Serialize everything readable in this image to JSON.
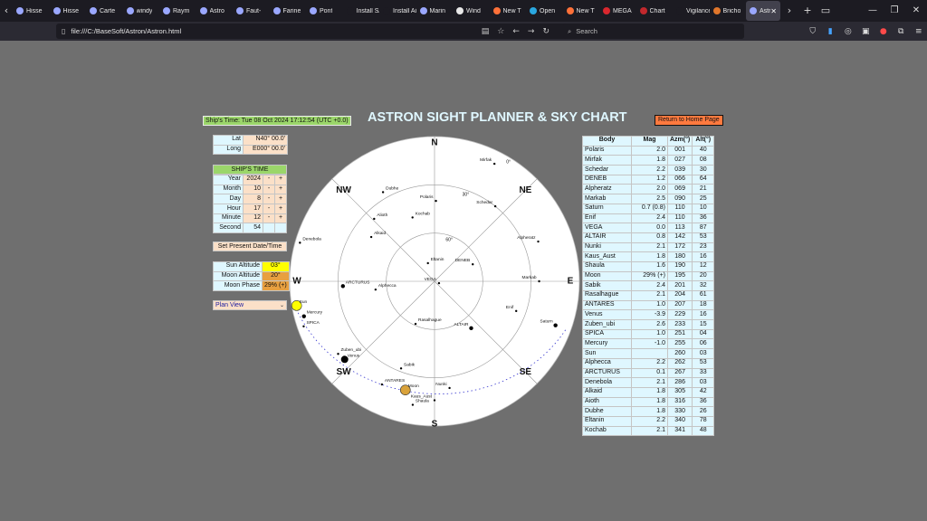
{
  "browser": {
    "tabs": [
      {
        "label": "Hisse",
        "color": "#9aa7ff"
      },
      {
        "label": "Hisse",
        "color": "#9aa7ff"
      },
      {
        "label": "Carte",
        "color": "#9aa7ff"
      },
      {
        "label": "windy",
        "color": "#9aa7ff"
      },
      {
        "label": "Raym",
        "color": "#9aa7ff"
      },
      {
        "label": "Astro",
        "color": "#9aa7ff"
      },
      {
        "label": "Faut-",
        "color": "#9aa7ff"
      },
      {
        "label": "Farine",
        "color": "#9aa7ff"
      },
      {
        "label": "Pont",
        "color": "#9aa7ff"
      },
      {
        "label": "Install SAS",
        "color": "#1c1b22"
      },
      {
        "label": "Install Airl",
        "color": "#1c1b22"
      },
      {
        "label": "Marin",
        "color": "#9aa7ff"
      },
      {
        "label": "Wind",
        "color": "#e8e8e8"
      },
      {
        "label": "New T",
        "color": "#ff7139"
      },
      {
        "label": "Open",
        "color": "#2aa7e0"
      },
      {
        "label": "New T",
        "color": "#ff7139"
      },
      {
        "label": "MEGA",
        "color": "#d9272e"
      },
      {
        "label": "Chart",
        "color": "#c2282d"
      },
      {
        "label": "Vigilance",
        "color": "#1c1b22"
      },
      {
        "label": "Bricho",
        "color": "#e0762b"
      },
      {
        "label": "Astron",
        "color": "#9aa7ff",
        "active": true
      }
    ],
    "url": "file:///C:/BaseSoft/Astron/Astron.html",
    "search_placeholder": "Search"
  },
  "header": {
    "ship_time": "Ship's Time: Tue 08 Oct 2024 17:12:54 (UTC +0.0)",
    "title": "ASTRON SIGHT PLANNER & SKY CHART",
    "home_button": "Return to Home Page"
  },
  "position": {
    "lat_label": "Lat",
    "lat_value": "N40° 00.0'",
    "long_label": "Long",
    "long_value": "E000° 00.0'"
  },
  "ships_time": {
    "header": "SHIP'S TIME",
    "minus": "-",
    "plus": "+",
    "rows": [
      {
        "label": "Year",
        "value": "2024"
      },
      {
        "label": "Month",
        "value": "10"
      },
      {
        "label": "Day",
        "value": "8"
      },
      {
        "label": "Hour",
        "value": "17"
      },
      {
        "label": "Minute",
        "value": "12"
      }
    ],
    "second_label": "Second",
    "second_value": "54",
    "set_button": "Set Present Date/Time"
  },
  "sun_moon": {
    "sun_alt_label": "Sun Altitude",
    "sun_alt": "03°",
    "moon_alt_label": "Moon Altitude",
    "moon_alt": "20°",
    "moon_phase_label": "Moon Phase",
    "moon_phase": "29% (+)",
    "colors": {
      "sun_alt": "#ffff00",
      "moon_alt": "#e8a040",
      "moon_phase": "#e8a040"
    }
  },
  "view_select": {
    "selected": "Plan View"
  },
  "sky_chart": {
    "directions": {
      "N": "N",
      "NE": "NE",
      "E": "E",
      "SE": "SE",
      "S": "S",
      "SW": "SW",
      "W": "W",
      "NW": "NW"
    },
    "ring_labels": [
      "0°",
      "30°",
      "60°"
    ],
    "objects": [
      {
        "name": "Polaris",
        "az": 1,
        "alt": 40,
        "type": "star"
      },
      {
        "name": "Mirfak",
        "az": 27,
        "alt": 8,
        "type": "star"
      },
      {
        "name": "Schedar",
        "az": 39,
        "alt": 30,
        "type": "star"
      },
      {
        "name": "DENEB",
        "az": 66,
        "alt": 64,
        "type": "star"
      },
      {
        "name": "Alpheratz",
        "az": 69,
        "alt": 21,
        "type": "star"
      },
      {
        "name": "Markab",
        "az": 90,
        "alt": 25,
        "type": "star"
      },
      {
        "name": "Saturn",
        "az": 110,
        "alt": 10,
        "type": "planet"
      },
      {
        "name": "Enif",
        "az": 110,
        "alt": 36,
        "type": "star"
      },
      {
        "name": "VEGA",
        "az": 113,
        "alt": 87,
        "type": "star"
      },
      {
        "name": "ALTAIR",
        "az": 142,
        "alt": 53,
        "type": "planet"
      },
      {
        "name": "Nunki",
        "az": 172,
        "alt": 23,
        "type": "star"
      },
      {
        "name": "Kaus_Aust",
        "az": 180,
        "alt": 16,
        "type": "star"
      },
      {
        "name": "Shaula",
        "az": 190,
        "alt": 12,
        "type": "star"
      },
      {
        "name": "Moon",
        "az": 195,
        "alt": 20,
        "type": "moon"
      },
      {
        "name": "Sabik",
        "az": 201,
        "alt": 32,
        "type": "star"
      },
      {
        "name": "Rasalhague",
        "az": 204,
        "alt": 61,
        "type": "star"
      },
      {
        "name": "ANTARES",
        "az": 207,
        "alt": 18,
        "type": "star"
      },
      {
        "name": "Venus",
        "az": 229,
        "alt": 16,
        "type": "venus"
      },
      {
        "name": "Zuben_ubi",
        "az": 233,
        "alt": 15,
        "type": "star"
      },
      {
        "name": "SPICA",
        "az": 251,
        "alt": 4,
        "type": "star"
      },
      {
        "name": "Mercury",
        "az": 255,
        "alt": 6,
        "type": "planet"
      },
      {
        "name": "Sun",
        "az": 260,
        "alt": 3,
        "type": "sun"
      },
      {
        "name": "Alphecca",
        "az": 262,
        "alt": 53,
        "type": "star"
      },
      {
        "name": "ARCTURUS",
        "az": 267,
        "alt": 33,
        "type": "planet"
      },
      {
        "name": "Denebola",
        "az": 286,
        "alt": 3,
        "type": "star"
      },
      {
        "name": "Alkaid",
        "az": 305,
        "alt": 42,
        "type": "star"
      },
      {
        "name": "Alioth",
        "az": 316,
        "alt": 36,
        "type": "star"
      },
      {
        "name": "Dubhe",
        "az": 330,
        "alt": 26,
        "type": "star"
      },
      {
        "name": "Eltanin",
        "az": 340,
        "alt": 78,
        "type": "star"
      },
      {
        "name": "Kochab",
        "az": 341,
        "alt": 48,
        "type": "star"
      }
    ]
  },
  "star_table": {
    "headers": [
      "Body",
      "Mag",
      "Azm(°)",
      "Alt(°)"
    ],
    "rows": [
      [
        "Polaris",
        "2.0",
        "001",
        "40"
      ],
      [
        "Mirfak",
        "1.8",
        "027",
        "08"
      ],
      [
        "Schedar",
        "2.2",
        "039",
        "30"
      ],
      [
        "DENEB",
        "1.2",
        "066",
        "64"
      ],
      [
        "Alpheratz",
        "2.0",
        "069",
        "21"
      ],
      [
        "Markab",
        "2.5",
        "090",
        "25"
      ],
      [
        "Saturn",
        "0.7 (0.8)",
        "110",
        "10"
      ],
      [
        "Enif",
        "2.4",
        "110",
        "36"
      ],
      [
        "VEGA",
        "0.0",
        "113",
        "87"
      ],
      [
        "ALTAIR",
        "0.8",
        "142",
        "53"
      ],
      [
        "Nunki",
        "2.1",
        "172",
        "23"
      ],
      [
        "Kaus_Aust",
        "1.8",
        "180",
        "16"
      ],
      [
        "Shaula",
        "1.6",
        "190",
        "12"
      ],
      [
        "Moon",
        "29% (+)",
        "195",
        "20"
      ],
      [
        "Sabik",
        "2.4",
        "201",
        "32"
      ],
      [
        "Rasalhague",
        "2.1",
        "204",
        "61"
      ],
      [
        "ANTARES",
        "1.0",
        "207",
        "18"
      ],
      [
        "Venus",
        "-3.9",
        "229",
        "16"
      ],
      [
        "Zuben_ubi",
        "2.6",
        "233",
        "15"
      ],
      [
        "SPICA",
        "1.0",
        "251",
        "04"
      ],
      [
        "Mercury",
        "-1.0",
        "255",
        "06"
      ],
      [
        "Sun",
        "",
        "260",
        "03"
      ],
      [
        "Alphecca",
        "2.2",
        "262",
        "53"
      ],
      [
        "ARCTURUS",
        "0.1",
        "267",
        "33"
      ],
      [
        "Denebola",
        "2.1",
        "286",
        "03"
      ],
      [
        "Alkaid",
        "1.8",
        "305",
        "42"
      ],
      [
        "Aioth",
        "1.8",
        "316",
        "36"
      ],
      [
        "Dubhe",
        "1.8",
        "330",
        "26"
      ],
      [
        "Eltanin",
        "2.2",
        "340",
        "78"
      ],
      [
        "Kochab",
        "2.1",
        "341",
        "48"
      ]
    ]
  }
}
